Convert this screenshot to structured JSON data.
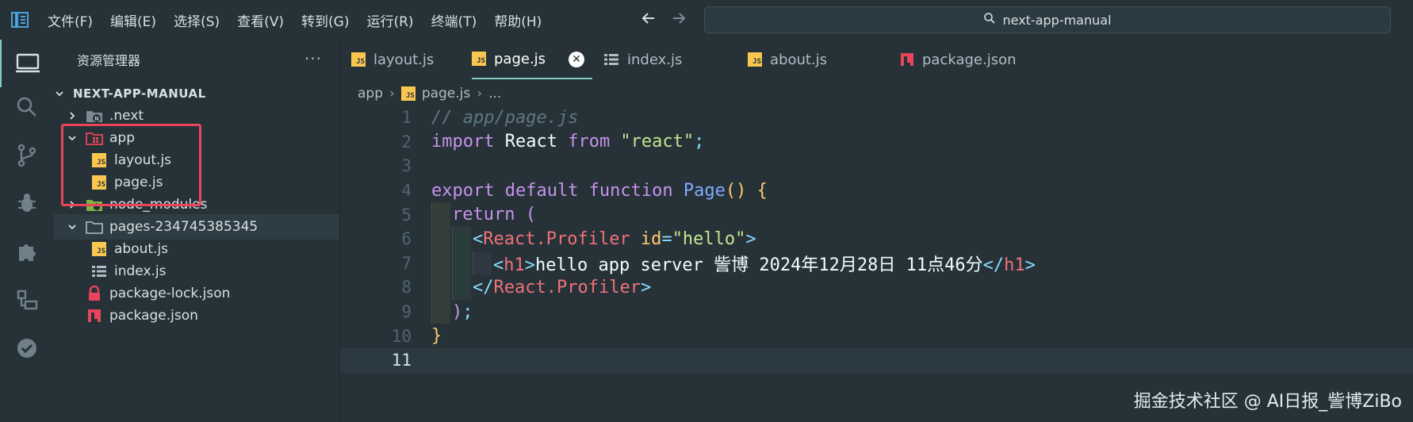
{
  "titlebar": {
    "menu": [
      "文件(F)",
      "编辑(E)",
      "选择(S)",
      "查看(V)",
      "转到(G)",
      "运行(R)",
      "终端(T)",
      "帮助(H)"
    ],
    "search_text": "next-app-manual"
  },
  "activity_bar": {
    "items": [
      "explorer-icon",
      "search-icon",
      "source-control-icon",
      "debug-icon",
      "extensions-icon",
      "remote-explorer-icon",
      "testing-icon"
    ]
  },
  "sidebar": {
    "title": "资源管理器",
    "more": "···",
    "root": "NEXT-APP-MANUAL",
    "items": [
      {
        "label": ".next"
      },
      {
        "label": "app"
      },
      {
        "label": "layout.js"
      },
      {
        "label": "page.js"
      },
      {
        "label": "node_modules"
      },
      {
        "label": "pages-234745385345"
      },
      {
        "label": "about.js"
      },
      {
        "label": "index.js"
      },
      {
        "label": "package-lock.json"
      },
      {
        "label": "package.json"
      }
    ]
  },
  "tabs": [
    {
      "label": "layout.js"
    },
    {
      "label": "page.js"
    },
    {
      "label": "index.js"
    },
    {
      "label": "about.js"
    },
    {
      "label": "package.json"
    }
  ],
  "breadcrumb": {
    "folder": "app",
    "file": "page.js",
    "more": "..."
  },
  "code": {
    "line_numbers": [
      "1",
      "2",
      "3",
      "4",
      "5",
      "6",
      "7",
      "8",
      "9",
      "10",
      "11"
    ],
    "l1_comment": "// app/page.js",
    "l2_import": "import",
    "l2_react": " React ",
    "l2_from": "from",
    "l2_str": " \"react\"",
    "l2_semi": ";",
    "l4_export": "export default function",
    "l4_page": " Page",
    "l4_parens": "()",
    "l4_brace": " {",
    "l5_return": "return",
    "l5_paren": " (",
    "l6_open": "<",
    "l6_tag": "React.Profiler",
    "l6_attr": " id",
    "l6_eq": "=",
    "l6_val": "\"hello\"",
    "l6_close": ">",
    "l7_open": "<",
    "l7_tag": "h1",
    "l7_close": ">",
    "l7_text": "hello app server 訾博 2024年12月28日 11点46分",
    "l7_end_open": "</",
    "l7_end_tag": "h1",
    "l7_end_close": ">",
    "l8_open": "</",
    "l8_tag": "React.Profiler",
    "l8_close": ">",
    "l9_paren": ")",
    "l9_semi": ";",
    "l10_brace": "}"
  },
  "watermark": "掘金技术社区 @ AI日报_訾博ZiBo"
}
